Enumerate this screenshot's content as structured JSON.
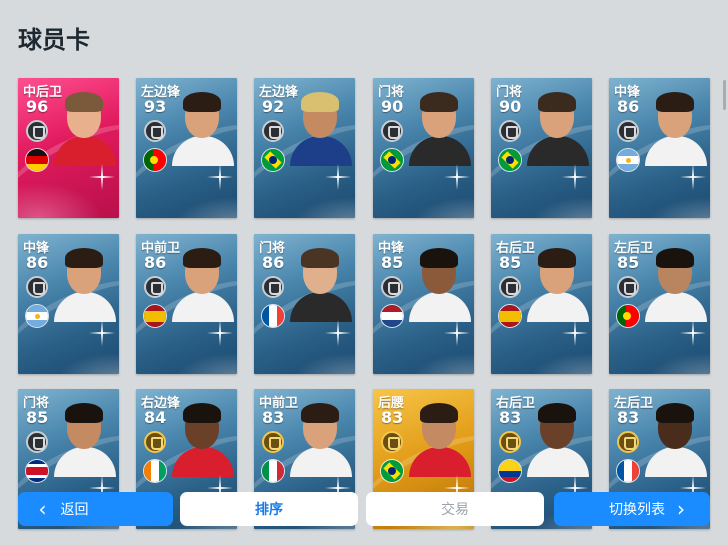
{
  "page": {
    "title": "球员卡"
  },
  "cards": [
    {
      "position": "中后卫",
      "rating": "96",
      "flag": "germany",
      "tier": "legend",
      "skin": "#e8b08c",
      "hair": "#7a5a3a",
      "shirt": "#d91f2e"
    },
    {
      "position": "左边锋",
      "rating": "93",
      "flag": "portugal",
      "tier": "normal",
      "skin": "#d9a27a",
      "hair": "#2b1d14",
      "shirt": "#f2f2f2"
    },
    {
      "position": "左边锋",
      "rating": "92",
      "flag": "brazil",
      "tier": "normal",
      "skin": "#c48a62",
      "hair": "#d8c070",
      "shirt": "#1d3f8a"
    },
    {
      "position": "门将",
      "rating": "90",
      "flag": "brazil",
      "tier": "normal",
      "skin": "#d9a27a",
      "hair": "#3b2a1e",
      "shirt": "#2a2a2a"
    },
    {
      "position": "门将",
      "rating": "90",
      "flag": "brazil",
      "tier": "normal",
      "skin": "#d9a27a",
      "hair": "#3b2a1e",
      "shirt": "#2a2a2a"
    },
    {
      "position": "中锋",
      "rating": "86",
      "flag": "argentina",
      "tier": "normal",
      "skin": "#d9a27a",
      "hair": "#2b1d14",
      "shirt": "#f2f2f2"
    },
    {
      "position": "中锋",
      "rating": "86",
      "flag": "argentina",
      "tier": "normal",
      "skin": "#d9a27a",
      "hair": "#2b1d14",
      "shirt": "#f2f2f2"
    },
    {
      "position": "中前卫",
      "rating": "86",
      "flag": "spain",
      "tier": "normal",
      "skin": "#d9a27a",
      "hair": "#2b1d14",
      "shirt": "#f2f2f2"
    },
    {
      "position": "门将",
      "rating": "86",
      "flag": "france",
      "tier": "normal",
      "skin": "#e0b08c",
      "hair": "#4a3424",
      "shirt": "#2a2a2a"
    },
    {
      "position": "中锋",
      "rating": "85",
      "flag": "netherlands",
      "tier": "normal",
      "skin": "#8a5a3a",
      "hair": "#1a120c",
      "shirt": "#f2f2f2"
    },
    {
      "position": "右后卫",
      "rating": "85",
      "flag": "spain",
      "tier": "normal",
      "skin": "#d9a27a",
      "hair": "#2b1d14",
      "shirt": "#f2f2f2"
    },
    {
      "position": "左后卫",
      "rating": "85",
      "flag": "portugal",
      "tier": "normal",
      "skin": "#b98460",
      "hair": "#1a120c",
      "shirt": "#f2f2f2"
    },
    {
      "position": "门将",
      "rating": "85",
      "flag": "costa-rica",
      "tier": "normal",
      "skin": "#c48a62",
      "hair": "#1a120c",
      "shirt": "#f2f2f2"
    },
    {
      "position": "右边锋",
      "rating": "84",
      "flag": "ivory-coast",
      "tier": "normal",
      "gold_badge": true,
      "skin": "#6a4028",
      "hair": "#1a120c",
      "shirt": "#d91f2e"
    },
    {
      "position": "中前卫",
      "rating": "83",
      "flag": "italy",
      "tier": "normal",
      "gold_badge": true,
      "skin": "#d9a27a",
      "hair": "#2b1d14",
      "shirt": "#f2f2f2"
    },
    {
      "position": "后腰",
      "rating": "83",
      "flag": "brazil",
      "tier": "gold",
      "gold_badge": true,
      "skin": "#c48a62",
      "hair": "#2b1d14",
      "shirt": "#d91f2e"
    },
    {
      "position": "右后卫",
      "rating": "83",
      "flag": "colombia",
      "tier": "normal",
      "gold_badge": true,
      "skin": "#6a4028",
      "hair": "#1a120c",
      "shirt": "#f2f2f2"
    },
    {
      "position": "左后卫",
      "rating": "83",
      "flag": "france",
      "tier": "normal",
      "gold_badge": true,
      "skin": "#4a2c1c",
      "hair": "#1a120c",
      "shirt": "#f2f2f2"
    }
  ],
  "toolbar": {
    "back_label": "返回",
    "sort_label": "排序",
    "trade_label": "交易",
    "switch_label": "切换列表"
  },
  "colors": {
    "accent": "#1a8cff",
    "card_blue": "#2a5f86",
    "legend_pink": "#e11a5e",
    "gold": "#e19a16"
  }
}
